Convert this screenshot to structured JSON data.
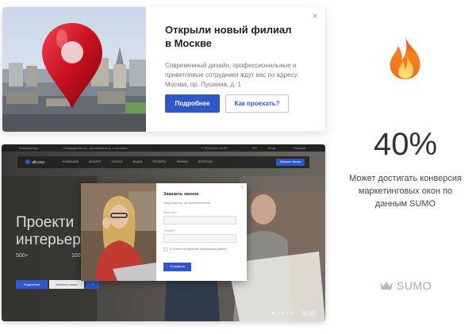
{
  "popup": {
    "title": "Открыли новый филиал в Москве",
    "description": "Современный дизайн, профессиональные и приветливые сотрудники ждут вас по адресу: Москва, пр. Пушкина, д. 1",
    "primary_button": "Подробнее",
    "secondary_button": "Как проехать?",
    "close_icon": "×"
  },
  "site": {
    "topbar": {
      "left": "Екатеринбург",
      "address": "Стандартная ул., приложение д. 1 на сайте",
      "phone": "+7 (000) 000-00-00",
      "lang": "RU",
      "extra1": "Вход",
      "extra2": "Корзина"
    },
    "logo": "allcorp",
    "nav": [
      "Компания",
      "Каталог",
      "Услуги",
      "Акции",
      "Проекты",
      "Тарифы",
      "Вопросы"
    ],
    "nav_button": "Заказать звонок",
    "headline_line1": "Проекти",
    "headline_line2": "интерьер",
    "stat1": "500+",
    "stat2": "100",
    "btn_details": "Подробнее",
    "btn_order": "Заказать визит",
    "btn_arrow": "→",
    "arrow_prev": "‹",
    "arrow_next": "›"
  },
  "modal": {
    "title": "Заказать звонок",
    "subtitle": "Представьтесь, мы вам перезвоним.",
    "label_name": "Ваше имя *",
    "value_name": "",
    "label_phone": "Телефон *",
    "value_phone": "",
    "consent": "Я согласен на обработку персональных данных",
    "submit": "Отправить",
    "close_icon": "×"
  },
  "stats": {
    "percent": "40%",
    "description": "Может достигать конверсия маркетинговых окон по данным SUMO"
  },
  "brand": {
    "name": "SUMO"
  },
  "colors": {
    "accent": "#2f57c8",
    "pin_red": "#d6192a"
  }
}
